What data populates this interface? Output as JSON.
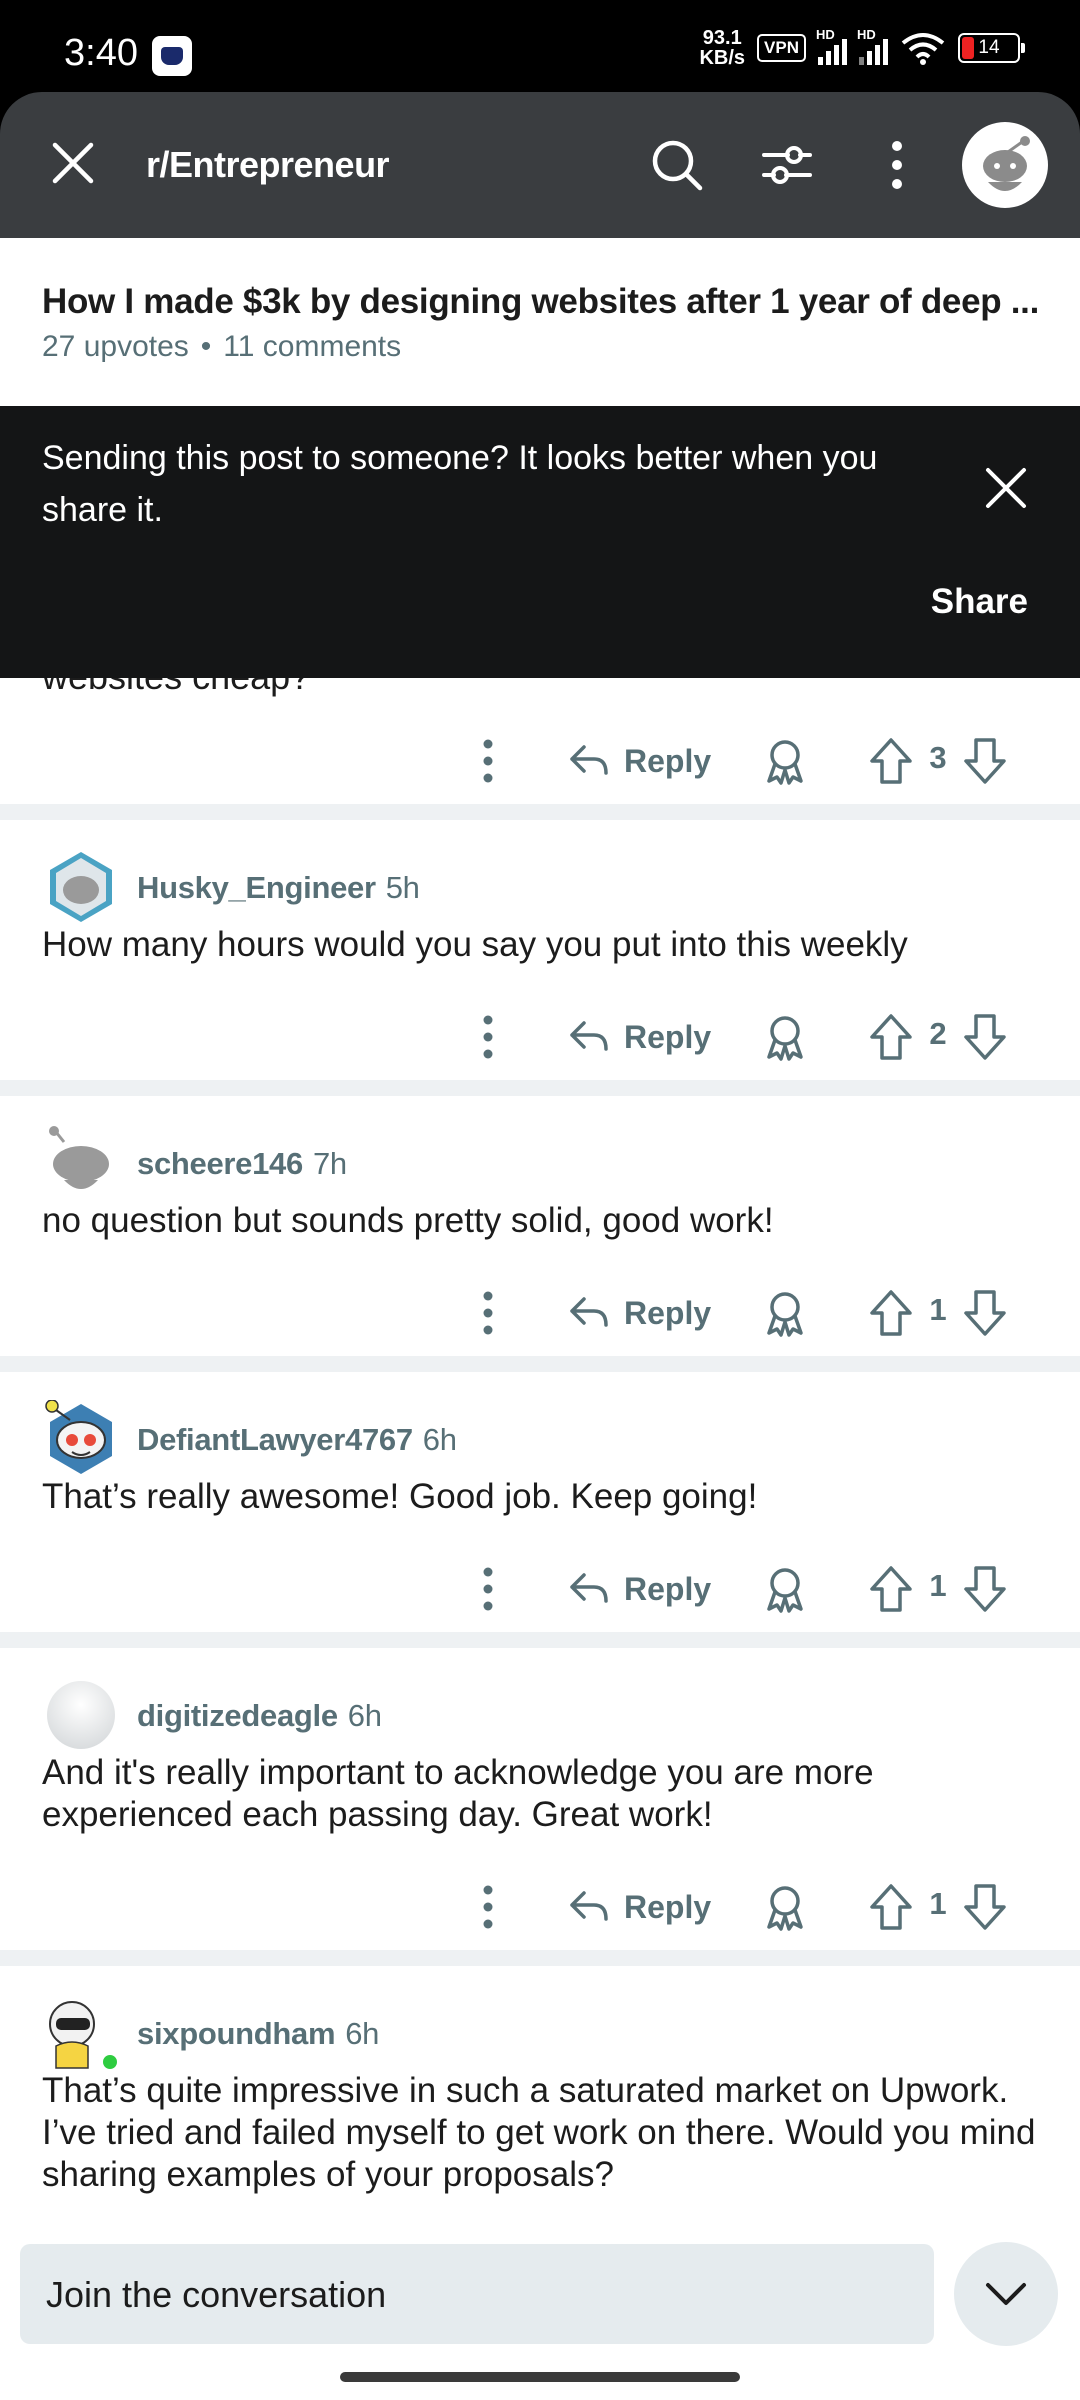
{
  "status_bar": {
    "time": "3:40",
    "net_speed_value": "93.1",
    "net_speed_unit": "KB/s",
    "vpn": "VPN",
    "hd1": "HD",
    "hd2": "HD",
    "battery": "14"
  },
  "app_bar": {
    "subreddit": "r/Entrepreneur",
    "icons": [
      "close-icon",
      "search-icon",
      "filter-icon",
      "more-vertical-icon",
      "avatar-icon"
    ]
  },
  "post": {
    "title": "How I made $3k by designing websites after 1 year of deep ...",
    "upvotes": "27 upvotes",
    "separator": "•",
    "comments": "11 comments"
  },
  "toast": {
    "message": "Sending this post to someone? It looks better when you share it.",
    "share_label": "Share"
  },
  "partial_comment": {
    "text": "websites cheap?",
    "votes": "3"
  },
  "reply_label": "Reply",
  "comments": [
    {
      "user": "Husky_Engineer",
      "time": "5h",
      "body": "How many hours would you say you put into this weekly",
      "votes": "2"
    },
    {
      "user": "scheere146",
      "time": "7h",
      "body": "no question but sounds pretty solid, good work!",
      "votes": "1"
    },
    {
      "user": "DefiantLawyer4767",
      "time": "6h",
      "body": "That’s really awesome! Good job. Keep going!",
      "votes": "1"
    },
    {
      "user": "digitizedeagle",
      "time": "6h",
      "body": "And it's really important to acknowledge you are more experienced each passing day. Great work!",
      "votes": "1"
    },
    {
      "user": "sixpoundham",
      "time": "6h",
      "body": "That’s quite impressive in such a saturated market on Upwork. I’ve tried and failed myself to get work on there. Would you mind sharing examples of your proposals?"
    }
  ],
  "composer": {
    "placeholder": "Join the conversation"
  },
  "colors": {
    "app_bar": "#3a3d40",
    "toast": "#141516",
    "meta_text": "#576f76",
    "separator": "#eef1f3",
    "composer": "#e5ebee"
  }
}
